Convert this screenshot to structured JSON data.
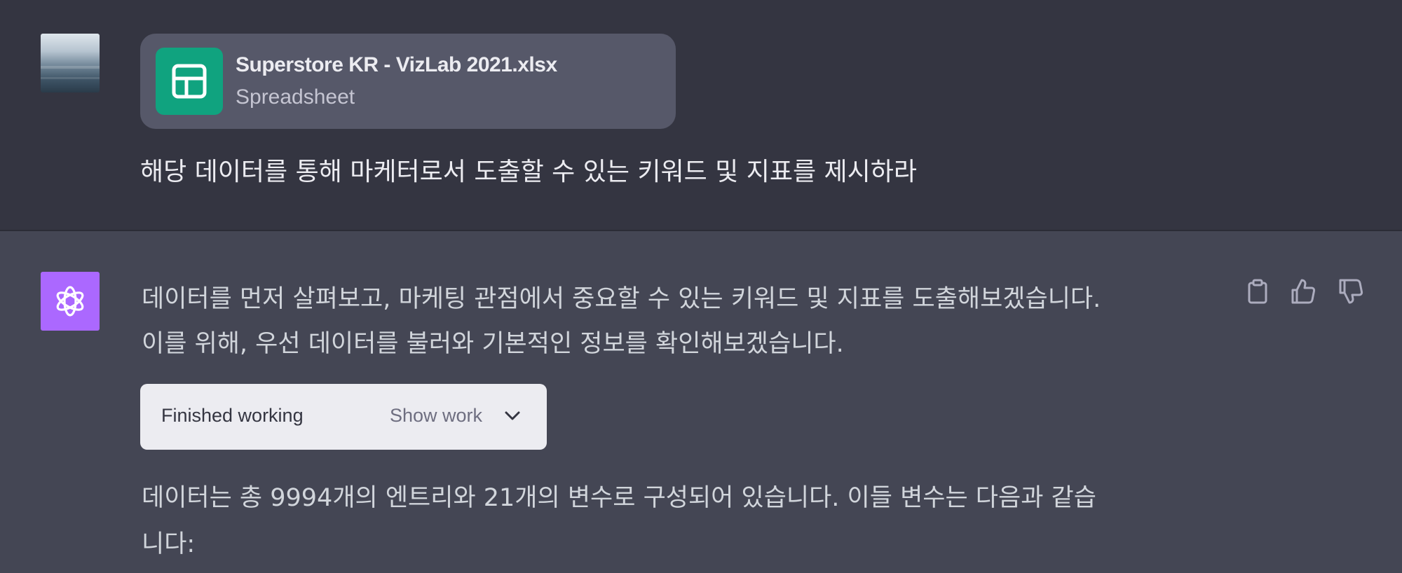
{
  "user": {
    "attachment": {
      "file_name": "Superstore KR - VizLab 2021.xlsx",
      "file_type": "Spreadsheet",
      "icon": "spreadsheet-icon"
    },
    "message": "해당 데이터를 통해 마케터로서 도출할 수 있는 키워드 및 지표를 제시하라"
  },
  "assistant": {
    "paragraph1": [
      "데이터를 먼저 살펴보고, 마케팅 관점에서 중요할 수 있는 키워드 및 지표를 도출해보겠습니다.",
      "이를 위해, 우선 데이터를 불러와 기본적인 정보를 확인해보겠습니다."
    ],
    "work": {
      "status": "Finished working",
      "toggle_label": "Show work"
    },
    "paragraph2": [
      "데이터는 총 9994개의 엔트리와 21개의 변수로 구성되어 있습니다. 이들 변수는 다음과 같습",
      "니다:"
    ],
    "actions": [
      "copy-icon",
      "thumbs-up-icon",
      "thumbs-down-icon"
    ]
  },
  "colors": {
    "user_bg": "#343541",
    "assistant_bg": "#444654",
    "file_icon_bg": "#10a37f",
    "gpt_avatar_bg": "#ab68ff",
    "file_card_bg": "#565869"
  }
}
